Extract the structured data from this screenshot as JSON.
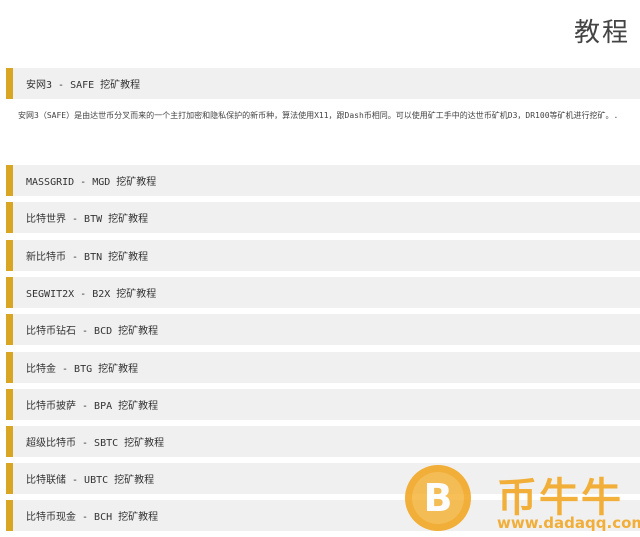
{
  "header": {
    "title": "教程"
  },
  "featured": {
    "title": "安网3 - SAFE 挖矿教程",
    "description": "安网3（SAFE）是由达世币分叉而来的一个主打加密和隐私保护的新币种，算法使用X11，跟Dash币相同。可以使用矿工手中的达世币矿机D3，DR100等矿机进行挖矿。..."
  },
  "list": {
    "items": [
      {
        "label": "MASSGRID - MGD 挖矿教程"
      },
      {
        "label": "比特世界 - BTW 挖矿教程"
      },
      {
        "label": "新比特币 - BTN 挖矿教程"
      },
      {
        "label": "SEGWIT2X - B2X 挖矿教程"
      },
      {
        "label": "比特币钻石 - BCD 挖矿教程"
      },
      {
        "label": "比特金 - BTG 挖矿教程"
      },
      {
        "label": "比特币披萨 - BPA 挖矿教程"
      },
      {
        "label": "超级比特币 - SBTC 挖矿教程"
      },
      {
        "label": "比特联储 - UBTC 挖矿教程"
      },
      {
        "label": "比特币现金 - BCH 挖矿教程"
      }
    ]
  },
  "watermark": {
    "coin_symbol": "B",
    "brand": "币牛牛",
    "url": "www.dadaqq.com"
  },
  "colors": {
    "accent": "#d9a624",
    "row_background": "#f0f0f0",
    "watermark": "#f2a318"
  }
}
